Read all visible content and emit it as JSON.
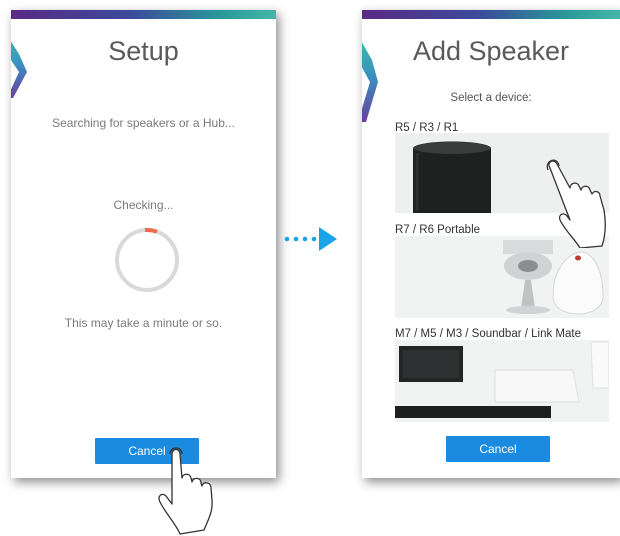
{
  "setup_screen": {
    "title": "Setup",
    "searching_text": "Searching for speakers or a Hub...",
    "checking_text": "Checking...",
    "wait_text": "This may take a minute or so.",
    "cancel_label": "Cancel",
    "spinner_accent": "#f06a4d"
  },
  "add_speaker_screen": {
    "title": "Add Speaker",
    "prompt": "Select a device:",
    "devices": [
      {
        "label": "R5 / R3 / R1"
      },
      {
        "label": "R7 / R6 Portable"
      },
      {
        "label": "M7 / M5 / M3 / Soundbar / Link Mate"
      }
    ],
    "cancel_label": "Cancel"
  },
  "colors": {
    "accent": "#1a8be0",
    "arrow": "#1aa3e8"
  }
}
